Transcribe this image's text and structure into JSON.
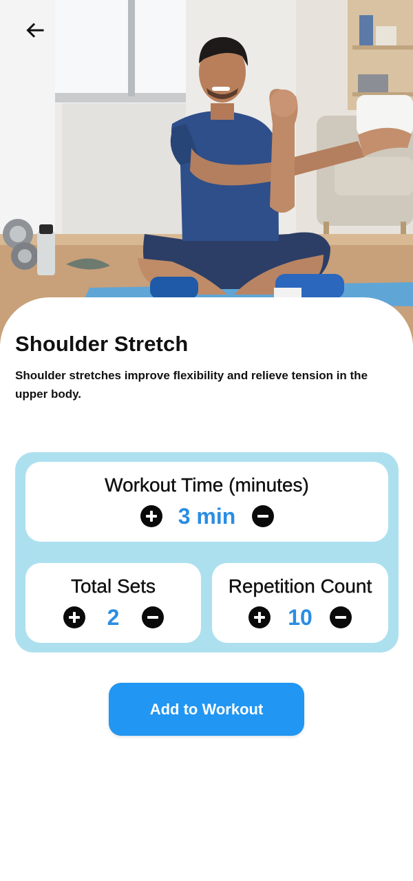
{
  "header": {
    "back_icon": "arrow-left-icon",
    "hero_image": "man-doing-shoulder-stretch-photo"
  },
  "exercise": {
    "title": "Shoulder Stretch",
    "description": "Shoulder stretches improve flexibility and relieve tension in the upper body."
  },
  "settings": {
    "workout_time": {
      "label": "Workout Time (minutes)",
      "value": "3 min",
      "increase_icon": "plus-circle-icon",
      "decrease_icon": "minus-circle-icon"
    },
    "total_sets": {
      "label": "Total Sets",
      "value": "2",
      "increase_icon": "plus-circle-icon",
      "decrease_icon": "minus-circle-icon"
    },
    "repetition_count": {
      "label": "Repetition Count",
      "value": "10",
      "increase_icon": "plus-circle-icon",
      "decrease_icon": "minus-circle-icon"
    }
  },
  "actions": {
    "add_label": "Add to Workout"
  },
  "colors": {
    "accent": "#2196f3",
    "value_text": "#2a8de3",
    "panel_background": "#ade0ef",
    "stepper_button": "#0a0a0a"
  }
}
